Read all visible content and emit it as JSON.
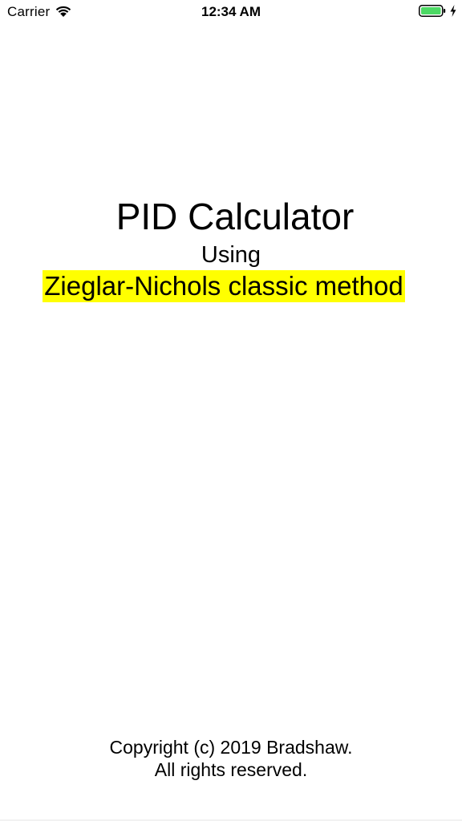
{
  "status_bar": {
    "carrier": "Carrier",
    "time": "12:34 AM",
    "battery_color": "#4cd964"
  },
  "main": {
    "title": "PID Calculator",
    "subtitle": "Using",
    "method": "Zieglar-Nichols classic method",
    "method_highlight_color": "#ffff00"
  },
  "footer": {
    "line1": "Copyright (c) 2019 Bradshaw.",
    "line2": "All rights reserved."
  }
}
